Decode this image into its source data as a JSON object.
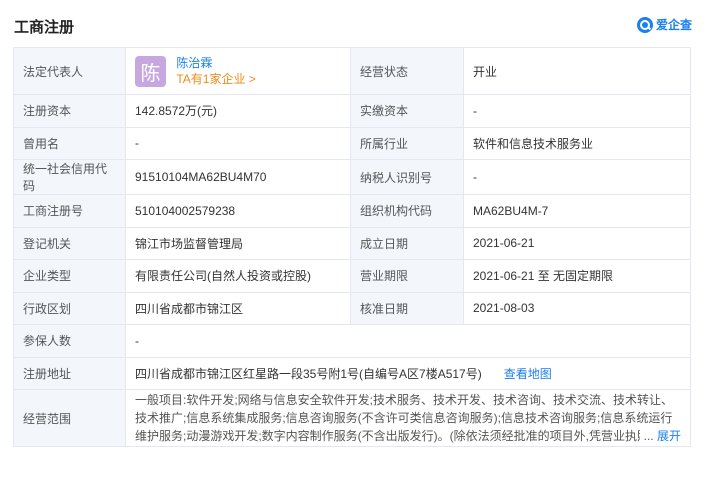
{
  "header": {
    "title": "工商注册",
    "brand": "爱企查"
  },
  "legal": {
    "label": "法定代表人",
    "avatar_char": "陈",
    "name": "陈治霖",
    "count_text": "TA有1家企业 >"
  },
  "status": {
    "label": "经营状态",
    "value": "开业"
  },
  "rows": [
    {
      "l1": "注册资本",
      "v1": "142.8572万(元)",
      "l2": "实缴资本",
      "v2": "-"
    },
    {
      "l1": "曾用名",
      "v1": "-",
      "l2": "所属行业",
      "v2": "软件和信息技术服务业"
    },
    {
      "l1": "统一社会信用代码",
      "v1": "91510104MA62BU4M70",
      "l2": "纳税人识别号",
      "v2": "-"
    },
    {
      "l1": "工商注册号",
      "v1": "510104002579238",
      "l2": "组织机构代码",
      "v2": "MA62BU4M-7"
    },
    {
      "l1": "登记机关",
      "v1": "锦江市场监督管理局",
      "l2": "成立日期",
      "v2": "2021-06-21"
    },
    {
      "l1": "企业类型",
      "v1": "有限责任公司(自然人投资或控股)",
      "l2": "营业期限",
      "v2": "2021-06-21 至 无固定期限"
    },
    {
      "l1": "行政区划",
      "v1": "四川省成都市锦江区",
      "l2": "核准日期",
      "v2": "2021-08-03"
    }
  ],
  "insured": {
    "label": "参保人数",
    "value": "-"
  },
  "address": {
    "label": "注册地址",
    "value": "四川省成都市锦江区红星路一段35号附1号(自编号A区7楼A517号)",
    "link": "查看地图"
  },
  "scope": {
    "label": "经营范围",
    "text": "一般项目:软件开发;网络与信息安全软件开发;技术服务、技术开发、技术咨询、技术交流、技术转让、技术推广;信息系统集成服务;信息咨询服务(不含许可类信息咨询服务);信息技术咨询服务;信息系统运行维护服务;动漫游戏开发;数字内容制作服务(不含出版发行)。(除依法须经批准的项目外,凭营业执照依法自主开展经营活动)",
    "ellipsis": "...",
    "expand": "展开"
  }
}
